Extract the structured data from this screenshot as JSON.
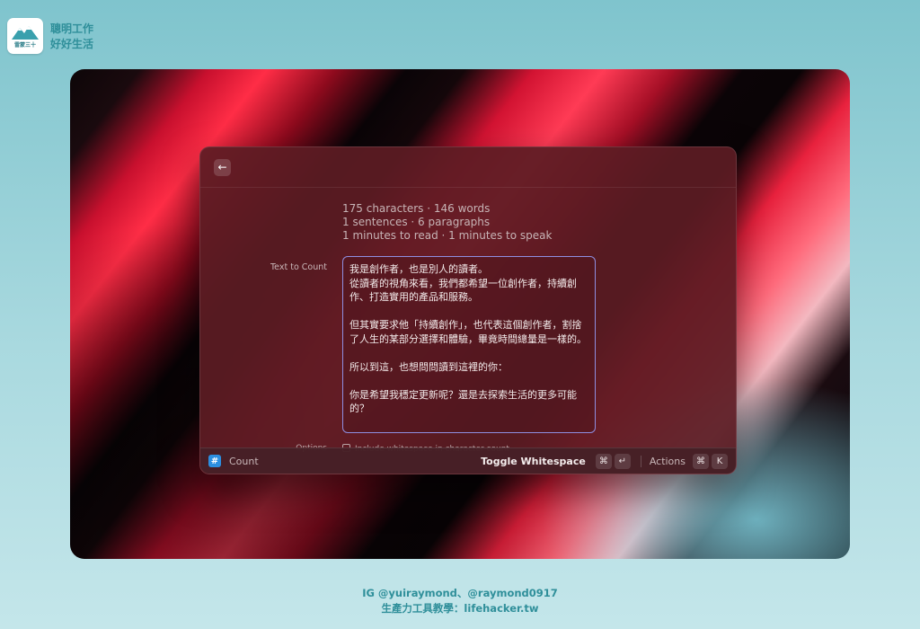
{
  "brand": {
    "logo_text": "雷蒙三十",
    "line1": "聰明工作",
    "line2": "好好生活",
    "colors": {
      "accent": "#2f8f9a"
    }
  },
  "window": {
    "back_icon": "arrow-left-icon",
    "stats": [
      "175 characters · 146 words",
      "1 sentences · 6 paragraphs",
      "1 minutes to read · 1 minutes to speak"
    ],
    "text_label": "Text to Count",
    "text_lines": [
      "我是創作者，也是別人的讀者。",
      "從讀者的視角來看，我們都希望一位創作者，持續創作、打造實用的產品和服務。",
      "",
      "但其實要求他「持續創作」，也代表這個創作者，割捨了人生的某部分選擇和體驗，畢竟時間總量是一樣的。",
      "",
      "所以到這，也想問問讀到這裡的你：",
      "",
      "你是希望我穩定更新呢？還是去探索生活的更多可能的？"
    ],
    "options_label": "Options",
    "options_checkbox_label": "Include whitespace in character count"
  },
  "bottombar": {
    "command_icon": "#",
    "command_name": "Count",
    "primary_action": "Toggle Whitespace",
    "primary_key1": "⌘",
    "primary_key2": "↵",
    "actions_label": "Actions",
    "actions_key1": "⌘",
    "actions_key2": "K"
  },
  "footer": {
    "line1": "IG @yuiraymond、@raymond0917",
    "line2": "生產力工具教學：lifehacker.tw"
  }
}
